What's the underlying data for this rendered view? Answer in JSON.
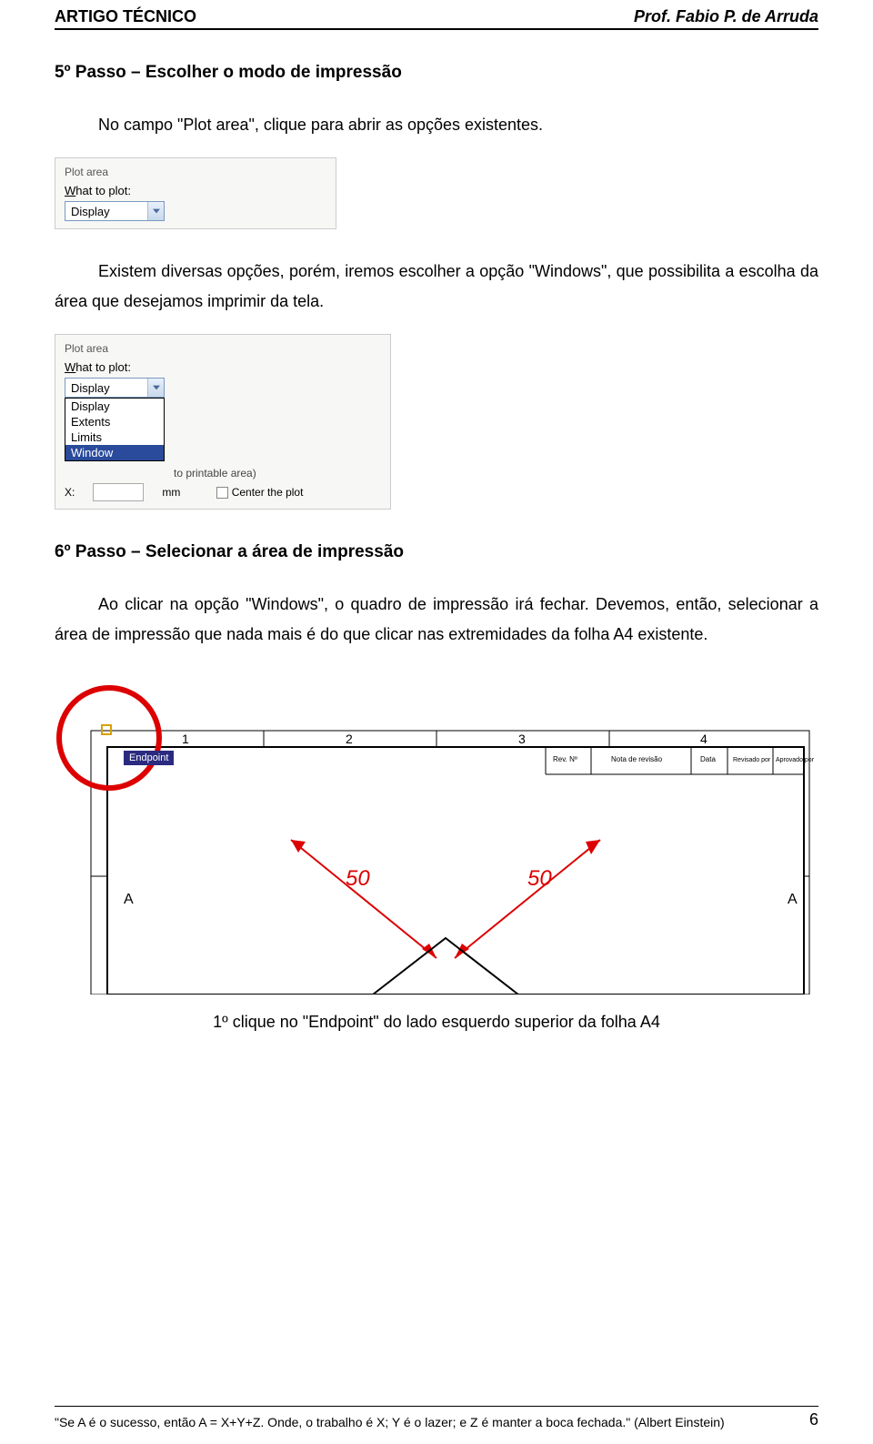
{
  "header": {
    "left": "ARTIGO TÉCNICO",
    "right_prefix": "Prof. Fabio P. de ",
    "right_bold": "Arruda"
  },
  "step5": {
    "title": "5º Passo – Escolher o modo de impressão",
    "p1": "No campo \"Plot area\", clique para abrir as opções existentes.",
    "p2": "Existem diversas opções, porém, iremos escolher a opção \"Windows\", que possibilita a escolha da área que desejamos imprimir da tela."
  },
  "plotarea1": {
    "group": "Plot area",
    "label_prefix": "W",
    "label_rest": "hat to plot:",
    "selected": "Display"
  },
  "plotarea2": {
    "group": "Plot area",
    "label_prefix": "W",
    "label_rest": "hat to plot:",
    "selected": "Display",
    "options": [
      "Display",
      "Extents",
      "Limits",
      "Window"
    ],
    "row2_text": "to printable area)",
    "bottom_x": "X",
    "bottom_unit": "mm",
    "bottom_check": "Center the plot"
  },
  "step6": {
    "title": "6º Passo – Selecionar a área de impressão",
    "p1": "Ao clicar na opção \"Windows\", o quadro de impressão irá fechar. Devemos, então, selecionar a área de impressão que nada mais é do que clicar nas extremidades da folha A4 existente."
  },
  "illustration": {
    "endpoint": "Endpoint",
    "topnums": [
      "1",
      "2",
      "3",
      "4"
    ],
    "sideA_left": "A",
    "sideA_right": "A",
    "dim": "50",
    "toplabels": [
      "Rev. Nº",
      "Nota de revisão",
      "Data",
      "Revisado por",
      "Aprovado por"
    ]
  },
  "caption": "1º clique no \"Endpoint\" do lado esquerdo superior da folha A4",
  "footer": {
    "quote": "\"Se A é o sucesso, então A = X+Y+Z. Onde, o trabalho é X; Y é o lazer; e Z é manter a boca fechada.\" (Albert Einstein)",
    "page": "6"
  }
}
